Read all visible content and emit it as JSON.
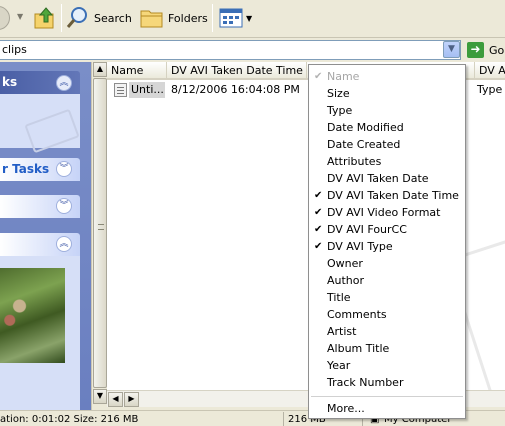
{
  "toolbar": {
    "search_label": "Search",
    "folders_label": "Folders"
  },
  "address": {
    "value": "clips",
    "go_label": "Go"
  },
  "taskpane": {
    "panel1_title": "ks",
    "panel2_title": "r Tasks"
  },
  "filelist": {
    "columns": [
      "Name",
      "DV AVI Taken Date Time",
      "DV AV"
    ],
    "rows": [
      {
        "name": "Unti...",
        "taken": "8/12/2006 16:04:08 PM",
        "type": "Type"
      }
    ]
  },
  "status": {
    "details": "ation: 0:01:02 Size: 216 MB",
    "size": "216 MB",
    "zone": "My Computer"
  },
  "menu": {
    "items": [
      {
        "label": "Name",
        "checked": true,
        "disabled": true
      },
      {
        "label": "Size",
        "checked": false
      },
      {
        "label": "Type",
        "checked": false
      },
      {
        "label": "Date Modified",
        "checked": false
      },
      {
        "label": "Date Created",
        "checked": false
      },
      {
        "label": "Attributes",
        "checked": false
      },
      {
        "label": "DV AVI Taken Date",
        "checked": false
      },
      {
        "label": "DV AVI Taken Date Time",
        "checked": true
      },
      {
        "label": "DV AVI Video Format",
        "checked": true
      },
      {
        "label": "DV AVI FourCC",
        "checked": true
      },
      {
        "label": "DV AVI Type",
        "checked": true
      },
      {
        "label": "Owner",
        "checked": false
      },
      {
        "label": "Author",
        "checked": false
      },
      {
        "label": "Title",
        "checked": false
      },
      {
        "label": "Comments",
        "checked": false
      },
      {
        "label": "Artist",
        "checked": false
      },
      {
        "label": "Album Title",
        "checked": false
      },
      {
        "label": "Year",
        "checked": false
      },
      {
        "label": "Track Number",
        "checked": false
      }
    ],
    "more_label": "More..."
  }
}
